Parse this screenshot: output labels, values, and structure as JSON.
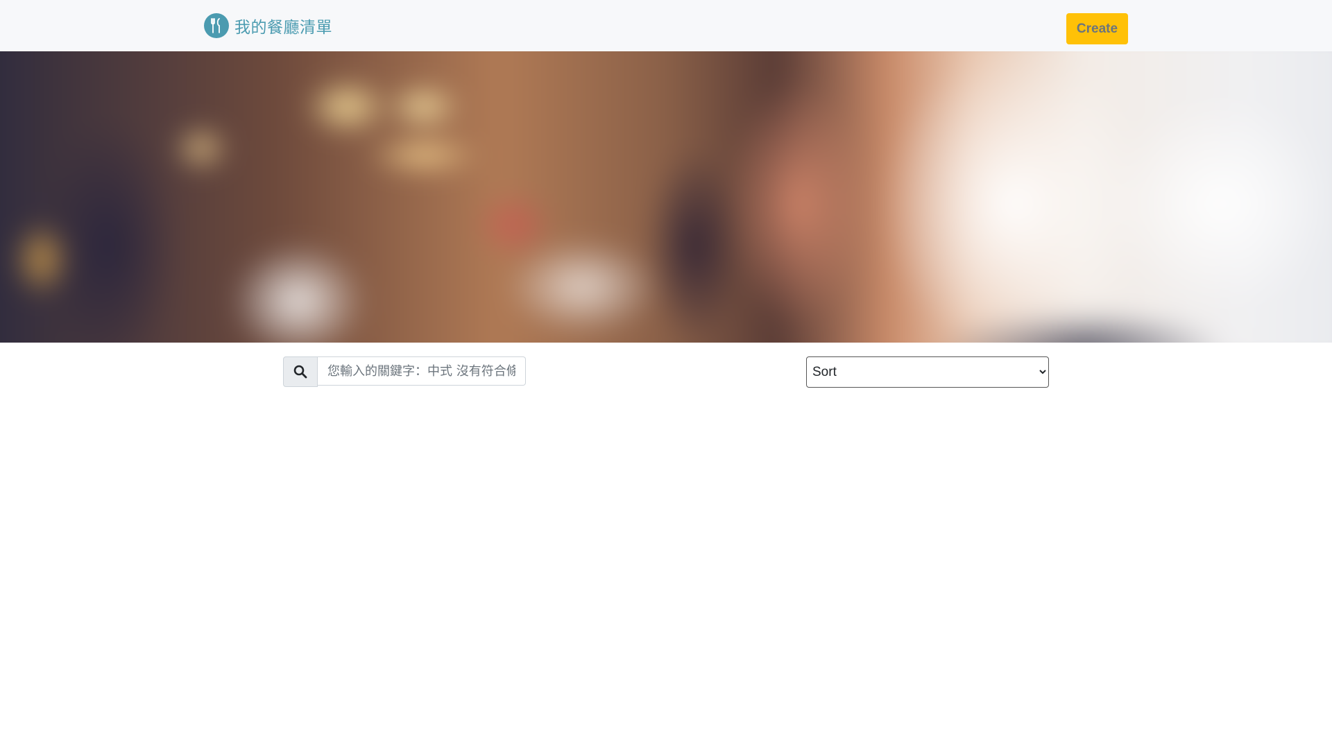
{
  "navbar": {
    "brand_title": "我的餐廳清單",
    "brand_icon": "utensils-icon",
    "create_label": "Create",
    "brand_color": "#4b9bb0",
    "create_color": "#ffc107"
  },
  "banner": {
    "description_icon": "restaurant-banner-image"
  },
  "search": {
    "icon": "search-icon",
    "placeholder": "您輸入的關鍵字：中式 沒有符合條件的餐廳",
    "value": ""
  },
  "sort": {
    "selected": "Sort"
  }
}
